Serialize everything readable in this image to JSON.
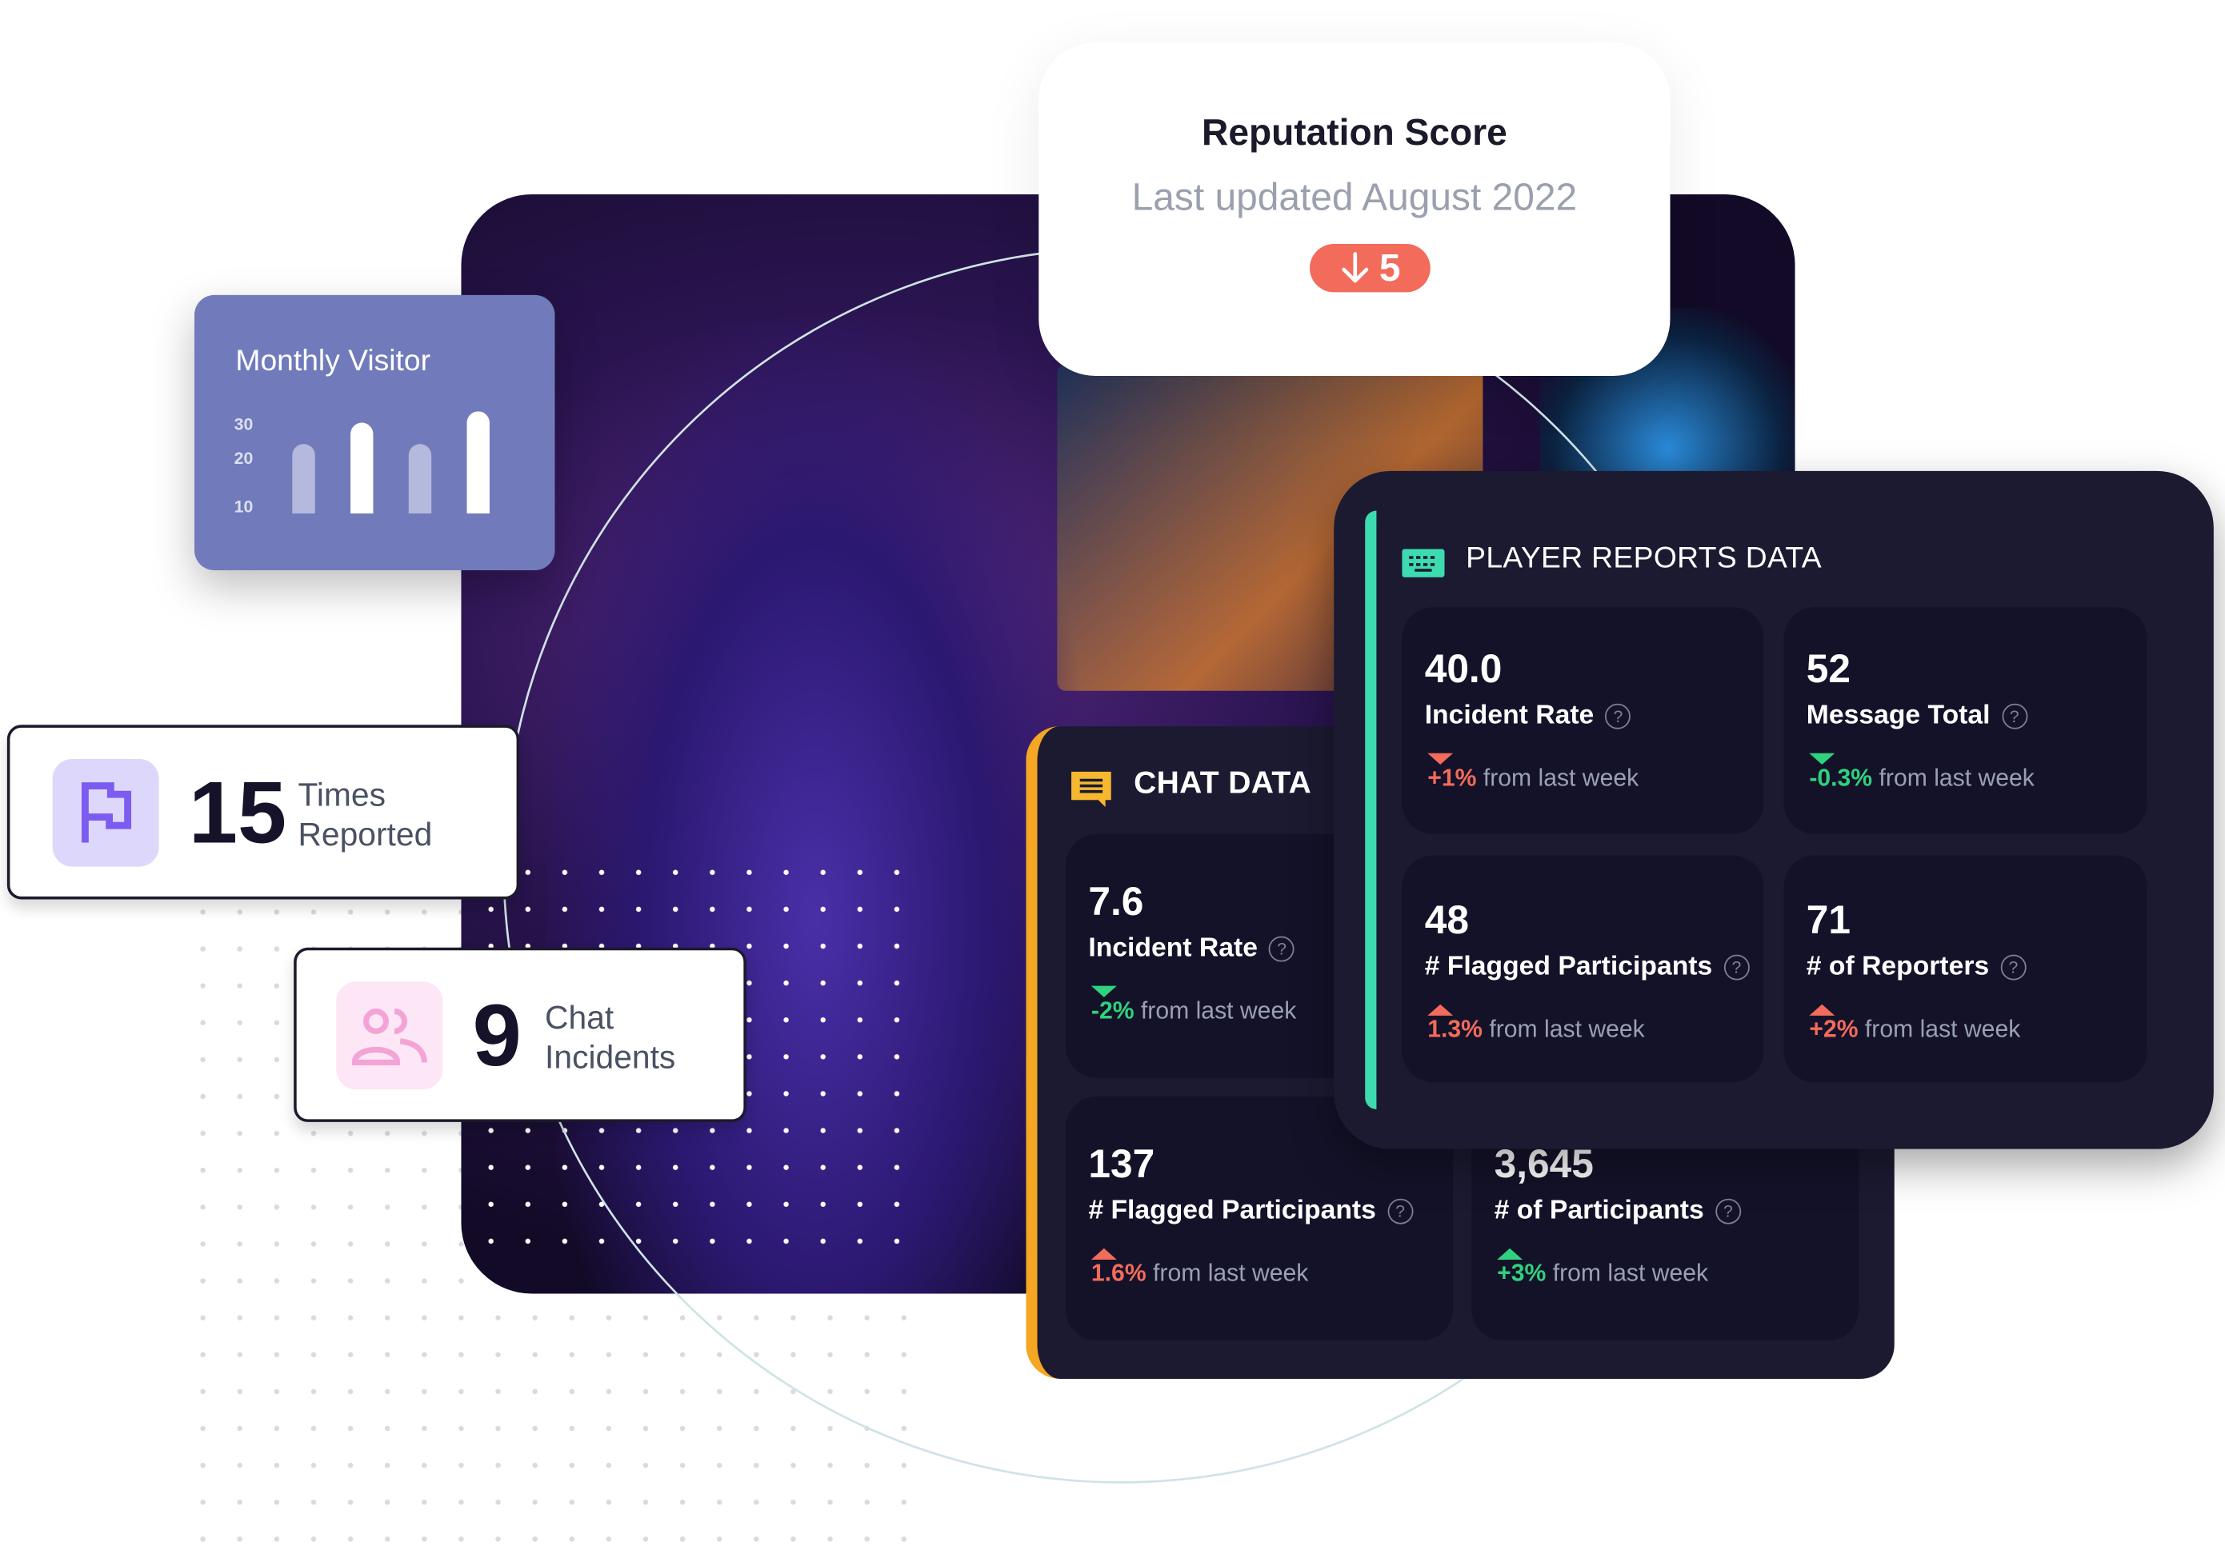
{
  "reputation": {
    "title": "Reputation Score",
    "subtitle": "Last updated August 2022",
    "change": "5",
    "change_icon": "arrow-down-icon",
    "change_color": "#f26b5b"
  },
  "monthly_visitor": {
    "title": "Monthly Visitor",
    "ticks": [
      "30",
      "20",
      "10"
    ],
    "bars": [
      {
        "value": 23,
        "highlight": false
      },
      {
        "value": 30,
        "highlight": true
      },
      {
        "value": 23,
        "highlight": false
      },
      {
        "value": 34,
        "highlight": true
      }
    ],
    "card_color": "#717bbb"
  },
  "times_reported": {
    "value": "15",
    "label_line1": "Times",
    "label_line2": "Reported",
    "icon": "flag-icon",
    "accent": "#7c5cf0"
  },
  "chat_incidents": {
    "value": "9",
    "label_line1": "Chat",
    "label_line2": "Incidents",
    "icon": "users-icon",
    "accent": "#f4a3d6"
  },
  "chat_data": {
    "title": "CHAT DATA",
    "accent": "#f5a623",
    "tiles": [
      {
        "value": "7.6",
        "label": "Incident Rate",
        "change": "-2%",
        "direction": "down",
        "color": "#2fd27d",
        "suffix": "from last week"
      },
      {
        "value": "137",
        "label": "# Flagged Participants",
        "change": "1.6%",
        "direction": "up",
        "color": "#f26b5b",
        "suffix": "from last week"
      },
      {
        "value": "3,645",
        "label": "# of Participants",
        "change": "+3%",
        "direction": "up",
        "color": "#2fd27d",
        "suffix": "from last week"
      }
    ]
  },
  "player_reports": {
    "title": "PLAYER REPORTS DATA",
    "accent": "#3ddbb0",
    "tiles": [
      {
        "value": "40.0",
        "label": "Incident Rate",
        "change": "+1%",
        "direction": "down",
        "color": "#f26b5b",
        "suffix": "from last week"
      },
      {
        "value": "52",
        "label": "Message Total",
        "change": "-0.3%",
        "direction": "down",
        "color": "#2fd27d",
        "suffix": "from last week"
      },
      {
        "value": "48",
        "label": "# Flagged Participants",
        "change": "1.3%",
        "direction": "up",
        "color": "#f26b5b",
        "suffix": "from last week"
      },
      {
        "value": "71",
        "label": "# of Reporters",
        "change": "+2%",
        "direction": "up",
        "color": "#f26b5b",
        "suffix": "from last week"
      }
    ]
  }
}
